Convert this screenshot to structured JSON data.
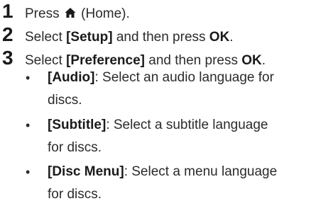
{
  "steps": [
    {
      "number": "1",
      "prefix": "Press",
      "icon": "home-icon",
      "suffix": "(Home)."
    },
    {
      "number": "2",
      "pre": "Select",
      "item": "[Setup]",
      "mid": "and then press",
      "key": "OK",
      "end": "."
    },
    {
      "number": "3",
      "pre": "Select",
      "item": "[Preference]",
      "mid": "and then press",
      "key": "OK",
      "end": ".",
      "bullets": [
        {
          "term": "[Audio]",
          "line1": ": Select an audio language for",
          "line2": "discs."
        },
        {
          "term": "[Subtitle]",
          "line1": ": Select a subtitle language",
          "line2": "for discs."
        },
        {
          "term": "[Disc Menu]",
          "line1": ": Select a menu language",
          "line2": "for discs."
        }
      ]
    }
  ]
}
